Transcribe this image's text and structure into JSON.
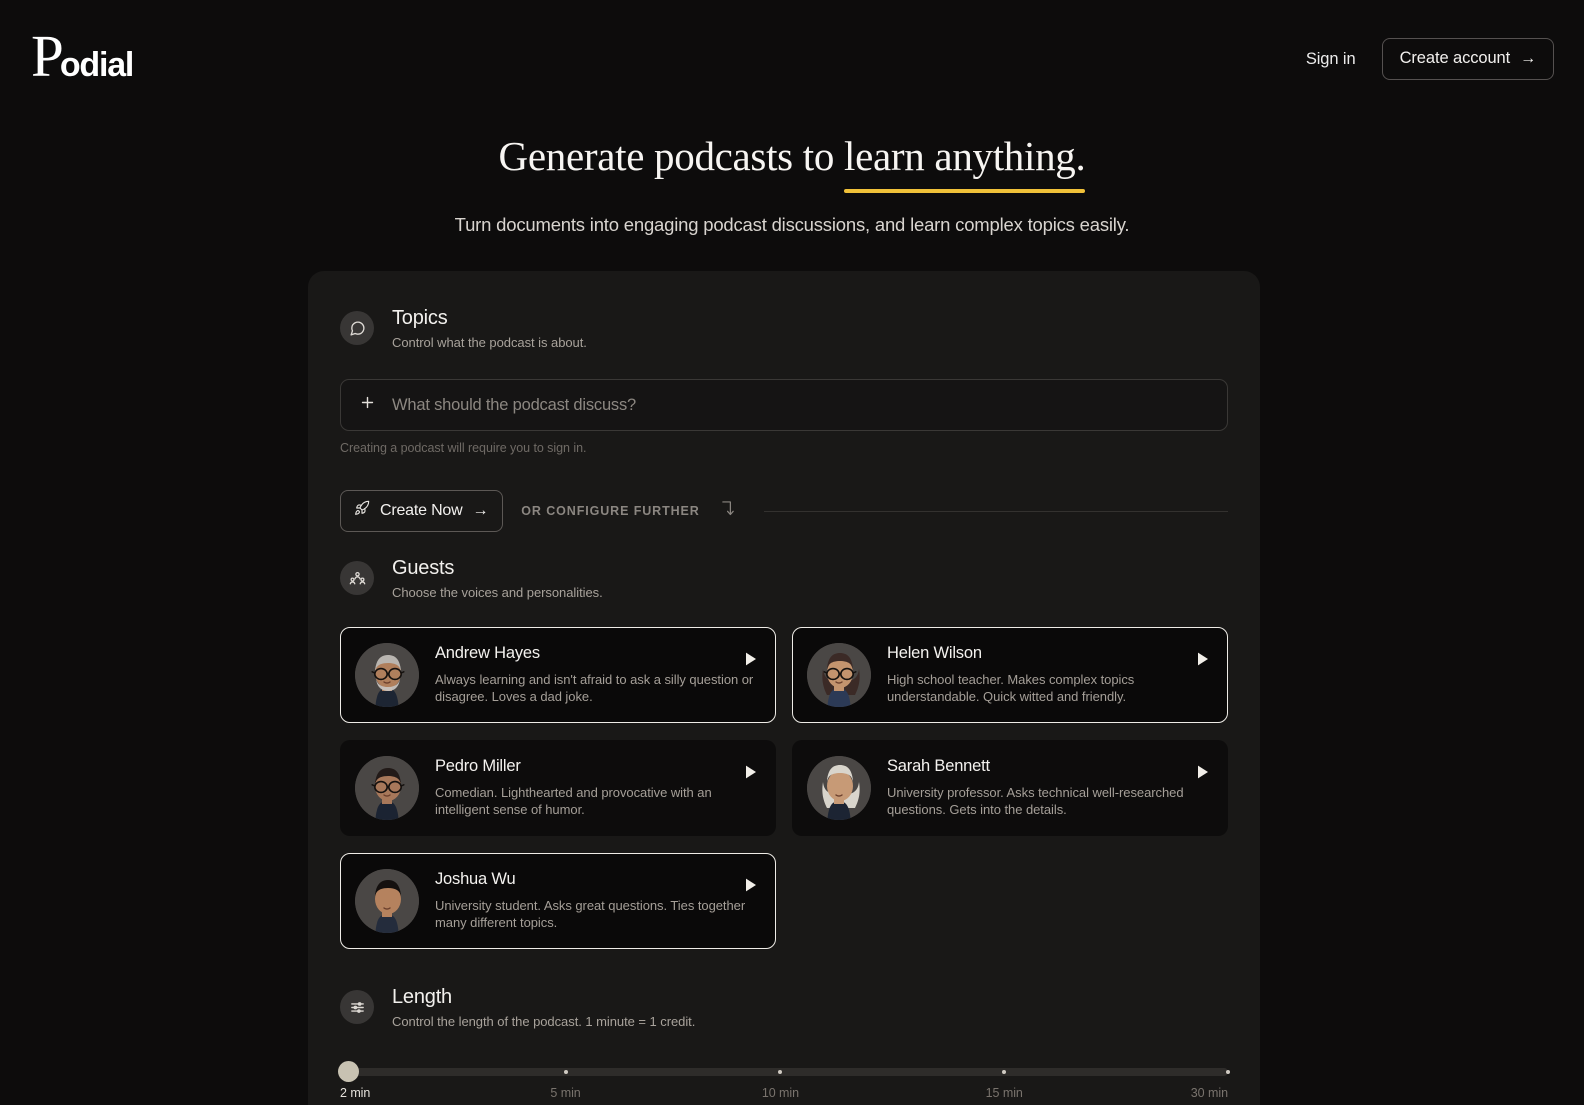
{
  "brand": {
    "logo_first": "P",
    "logo_rest": "odial"
  },
  "header": {
    "sign_in": "Sign in",
    "create_account": "Create account",
    "create_account_arrow": "→"
  },
  "hero": {
    "title_part1": "Generate podcasts to ",
    "title_highlight": "learn anything.",
    "subtitle": "Turn documents into engaging podcast discussions, and learn complex topics easily."
  },
  "topics": {
    "icon": "speech-bubble-icon",
    "title": "Topics",
    "subtitle": "Control what the podcast is about.",
    "input_value": "",
    "input_placeholder": "What should the podcast discuss?",
    "hint": "Creating a podcast will require you to sign in.",
    "create_now": "Create Now",
    "create_now_arrow": "→",
    "create_now_icon": "rocket-icon",
    "or_configure": "OR CONFIGURE FURTHER",
    "corner_arrow_icon": "arrow-corner-down-icon"
  },
  "guests": {
    "icon": "people-group-icon",
    "title": "Guests",
    "subtitle": "Choose the voices and personalities.",
    "items": [
      {
        "name": "Andrew Hayes",
        "desc": "Always learning and isn't afraid to ask a silly question or disagree. Loves a dad joke.",
        "selected": true,
        "avatar": "older-man-gray-hair-glasses-beard"
      },
      {
        "name": "Helen Wilson",
        "desc": "High school teacher. Makes complex topics understandable. Quick witted and friendly.",
        "selected": true,
        "avatar": "woman-curly-dark-hair-glasses"
      },
      {
        "name": "Pedro Miller",
        "desc": "Comedian. Lighthearted and provocative with an intelligent sense of humor.",
        "selected": false,
        "avatar": "man-dark-hair-glasses"
      },
      {
        "name": "Sarah Bennett",
        "desc": "University professor. Asks technical well-researched questions. Gets into the details.",
        "selected": false,
        "avatar": "woman-white-blonde-hair"
      },
      {
        "name": "Joshua Wu",
        "desc": "University student. Asks great questions. Ties together many different topics.",
        "selected": true,
        "avatar": "young-man-black-hair-hoodie"
      }
    ]
  },
  "length": {
    "icon": "sliders-icon",
    "title": "Length",
    "subtitle": "Control the length of the podcast. 1 minute = 1 credit.",
    "current_value": "2 min",
    "ticks": [
      {
        "label": "2 min",
        "percent": 0,
        "active": true
      },
      {
        "label": "5 min",
        "percent": 25.4,
        "active": false
      },
      {
        "label": "10 min",
        "percent": 49.6,
        "active": false
      },
      {
        "label": "15 min",
        "percent": 74.8,
        "active": false
      },
      {
        "label": "30 min",
        "percent": 100,
        "active": false
      }
    ]
  },
  "colors": {
    "page_bg": "#0d0c0c",
    "panel_bg": "#191817",
    "accent_underline": "#f0c139",
    "slider_thumb": "#c8c2b2",
    "card_selected_border": "#efece7"
  }
}
